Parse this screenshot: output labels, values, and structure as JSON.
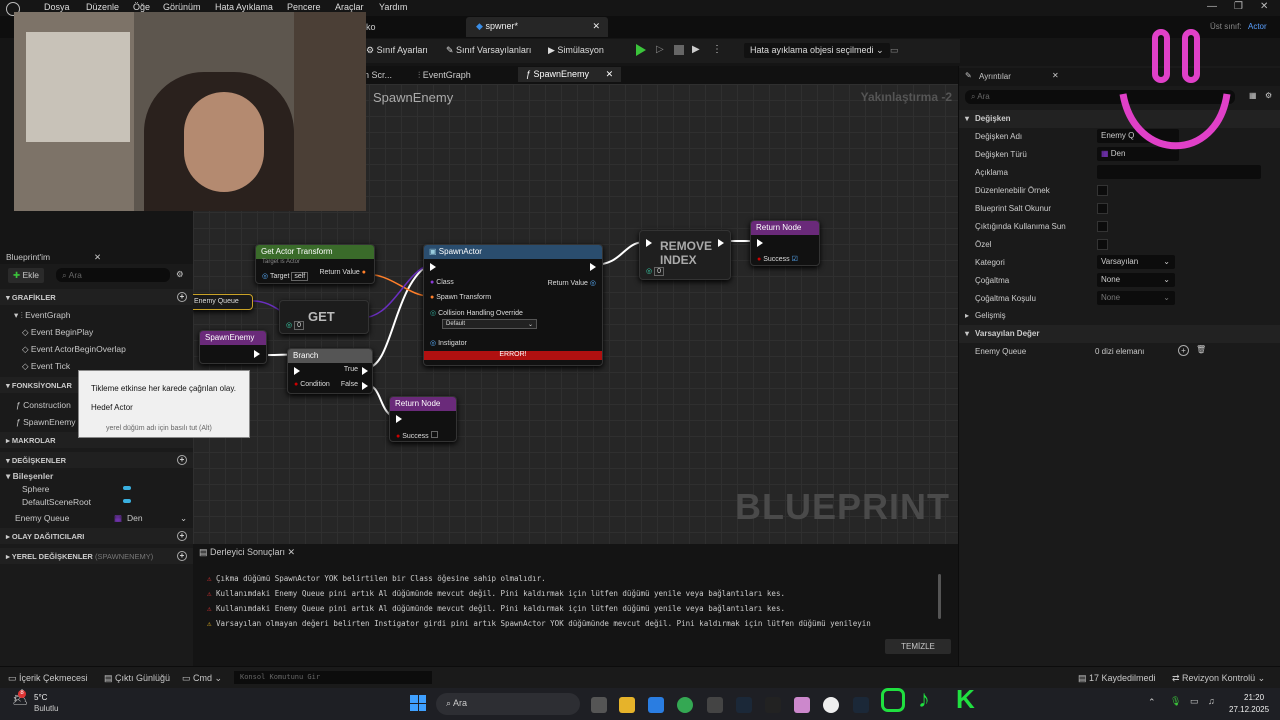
{
  "menu": [
    "Dosya",
    "Düzenle",
    "Öğe",
    "Görünüm",
    "Hata Ayıklama",
    "Pencere",
    "Araçlar",
    "Yardım"
  ],
  "window": {
    "parent_class_label": "Üst sınıf:",
    "parent_class": "Actor"
  },
  "tabs": {
    "partial_left": "ko",
    "active_doc": "spwner*"
  },
  "toolbar": {
    "class_settings": "Sınıf Ayarları",
    "class_defaults": "Sınıf Varsayılanları",
    "simulation": "Simülasyon",
    "debug_select": "Hata ayıklama objesi seçilmedi"
  },
  "graph_tabs": {
    "partial": "n Scr...",
    "event_graph": "EventGraph",
    "spawn_enemy": "SpawnEnemy"
  },
  "graph": {
    "title": "SpawnEnemy",
    "zoom": "Yakınlaştırma -2",
    "watermark": "BLUEPRINT"
  },
  "nodes": {
    "get_actor_transform": {
      "title": "Get Actor Transform",
      "subtitle": "Target is Actor",
      "target": "Target",
      "self": "self",
      "ret": "Return Value"
    },
    "spawn_actor": {
      "title": "SpawnActor",
      "class": "Class",
      "transform": "Spawn Transform",
      "collision": "Collision Handling Override",
      "default": "Default",
      "instigator": "Instigator",
      "ret": "Return Value",
      "error": "ERROR!"
    },
    "remove_index": {
      "title": "REMOVE INDEX",
      "val": "0"
    },
    "return1": {
      "title": "Return Node",
      "success": "Success"
    },
    "get": {
      "title": "GET",
      "val": "0"
    },
    "enemy_queue": "Enemy Queue",
    "spawn_enemy": "SpawnEnemy",
    "branch": {
      "title": "Branch",
      "condition": "Condition",
      "true": "True",
      "false": "False"
    },
    "return2": {
      "title": "Return Node",
      "success": "Success"
    }
  },
  "left_panel": {
    "title": "Blueprint'im",
    "add": "Ekle",
    "search_placeholder": "Ara",
    "graphs": "GRAFİKLER",
    "event_graph": "EventGraph",
    "event_begin_play": "Event BeginPlay",
    "event_overlap": "Event ActorBeginOverlap",
    "event_tick": "Event Tick",
    "functions": "FONKSİYONLAR",
    "construction": "Construction",
    "spawn_enemy": "SpawnEnemy",
    "macros": "MAKROLAR",
    "variables": "DEĞİŞKENLER",
    "components": "Bileşenler",
    "sphere": "Sphere",
    "scene_root": "DefaultSceneRoot",
    "enemy_queue": "Enemy Queue",
    "enemy_queue_type": "Den",
    "dispatchers": "OLAY DAĞITICILARI",
    "local_vars": "YEREL DEĞİŞKENLER",
    "local_vars_scope": "(SPAWNENEMY)"
  },
  "tooltip": {
    "line1": "Tikleme etkinse her karede çağrılan olay.",
    "line2": "Hedef Actor",
    "hint": "yerel düğüm adı için basılı tut (Alt)"
  },
  "details": {
    "title": "Ayrıntılar",
    "search_placeholder": "Ara",
    "variable_section": "Değişken",
    "rows": [
      {
        "label": "Değişken Adı",
        "value": "Enemy Q"
      },
      {
        "label": "Değişken Türü",
        "value": "Den"
      },
      {
        "label": "Açıklama",
        "value": ""
      },
      {
        "label": "Düzenlenebilir Örnek",
        "value": null
      },
      {
        "label": "Blueprint Salt Okunur",
        "value": null
      },
      {
        "label": "Çıktığında Kullanıma Sun",
        "value": null
      },
      {
        "label": "Özel",
        "value": null
      },
      {
        "label": "Kategori",
        "value": "Varsayılan"
      },
      {
        "label": "Çoğaltma",
        "value": "None"
      },
      {
        "label": "Çoğaltma Koşulu",
        "value": "None"
      }
    ],
    "advanced": "Gelişmiş",
    "default_section": "Varsayılan Değer",
    "default_label": "Enemy Queue",
    "default_value": "0 dizi elemanı"
  },
  "compiler": {
    "title": "Derleyici Sonuçları",
    "clear": "TEMİZLE",
    "logs": [
      "Çıkma düğümü SpawnActor YOK belirtilen bir Class öğesine sahip olmalıdır.",
      "Kullanımdaki Enemy Queue pini artık Al düğümünde mevcut değil. Pini kaldırmak için lütfen düğümü yenile veya bağlantıları kes.",
      "Kullanımdaki Enemy Queue pini artık Al düğümünde mevcut değil. Pini kaldırmak için lütfen düğümü yenile veya bağlantıları kes.",
      "Varsayılan olmayan değeri belirten Instigator girdi pini artık SpawnActor YOK düğümünde mevcut değil. Pini kaldırmak için lütfen düğümü yenileyin"
    ]
  },
  "statusbar": {
    "content_drawer": "İçerik Çekmecesi",
    "output_log": "Çıktı Günlüğü",
    "cmd": "Cmd",
    "console_placeholder": "Konsol Komutunu Gir",
    "saved": "17 Kaydedilmedi",
    "revision": "Revizyon Kontrolü"
  },
  "taskbar": {
    "weather_temp": "5°C",
    "weather_desc": "Bulutlu",
    "search": "Ara",
    "time": "21:20",
    "date": "27.12.2025",
    "badge": "8"
  }
}
